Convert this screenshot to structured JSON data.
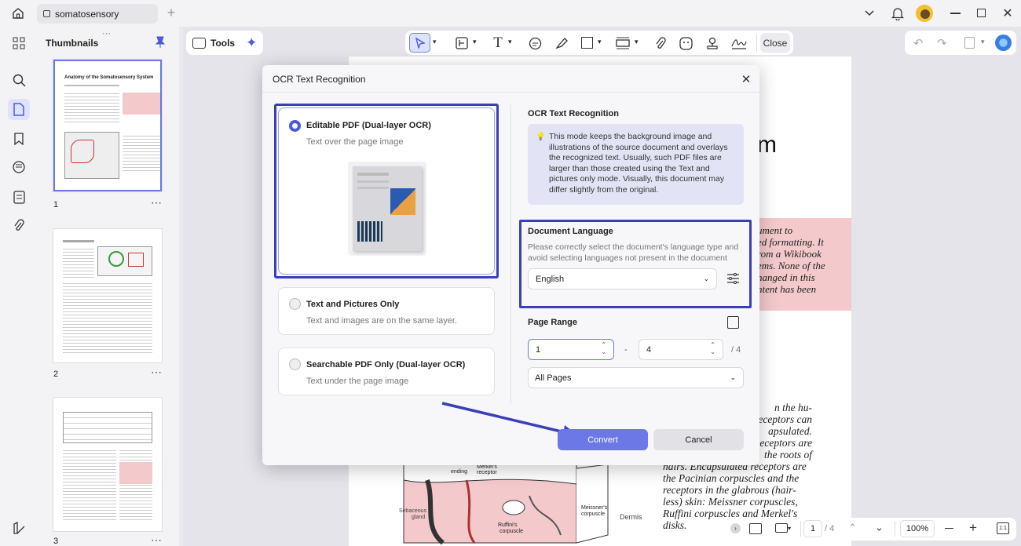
{
  "window": {
    "tab_title": "somatosensory"
  },
  "panel": {
    "title": "Thumbnails",
    "pages": [
      {
        "num": "1"
      },
      {
        "num": "2"
      },
      {
        "num": "3"
      }
    ],
    "thumb1_title": "Anatomy of the Somatosensory System"
  },
  "toolbar": {
    "tools_label": "Tools",
    "close_label": "Close"
  },
  "status": {
    "page": "1",
    "total": "/ 4",
    "zoom": "100%"
  },
  "doc": {
    "heading_frag": "m",
    "pink_lines": [
      "ument to",
      "ed formatting. It",
      "rom a Wikibook",
      "ems. None of the",
      "hanged in this",
      "ntent has been"
    ],
    "body_lines": [
      "n the hu-",
      "eceptors can",
      "apsulated.",
      "eceptors are",
      "the roots of",
      "hairs. Encapsulated receptors are",
      "the Pacinian corpuscles and the",
      "receptors in the glabrous (hair-",
      "less) skin: Meissner corpuscles,",
      "Ruffini corpuscles and Merkel's",
      "disks."
    ],
    "fig_labels": {
      "sebaceous": "Sebaceous",
      "gland": "gland",
      "ruffini": "Ruffini's",
      "corpuscle": "corpuscle",
      "meissner": "Meissner's",
      "meissner2": "corpuscle",
      "dermis": "Dermis",
      "ending": "ending",
      "merkel": "Merkel's",
      "receptor": "receptor"
    }
  },
  "dialog": {
    "title": "OCR Text Recognition",
    "options": [
      {
        "label": "Editable PDF (Dual-layer OCR)",
        "desc": "Text over the page image",
        "selected": true
      },
      {
        "label": "Text and Pictures Only",
        "desc": "Text and images are on the same layer.",
        "selected": false
      },
      {
        "label": "Searchable PDF Only (Dual-layer OCR)",
        "desc": "Text under the page image",
        "selected": false
      }
    ],
    "right_title": "OCR Text Recognition",
    "info": "This mode keeps the background image and illustrations of the source document and overlays the recognized text. Usually, such PDF files are larger than those created using the Text and pictures only mode. Visually, this document may differ slightly from the original.",
    "lang_title": "Document Language",
    "lang_desc": "Please correctly select the document's language type and avoid selecting languages not present in the document",
    "lang_value": "English",
    "range_title": "Page Range",
    "range_from": "1",
    "range_dash": "-",
    "range_to": "4",
    "range_total": "/ 4",
    "range_mode": "All Pages",
    "convert": "Convert",
    "cancel": "Cancel"
  },
  "colors": {
    "accent": "#4b5ad9",
    "highlight": "#3a3fb8",
    "pink": "#f3c9cc"
  }
}
